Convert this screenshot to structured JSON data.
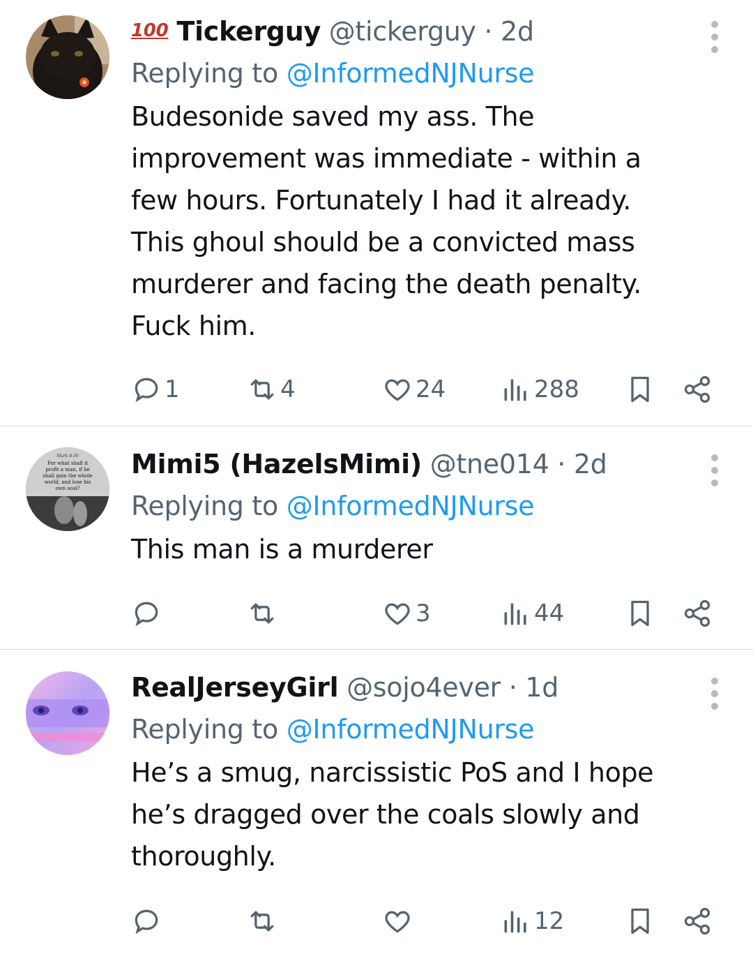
{
  "tweets": [
    {
      "badge": "100",
      "name": "Tickerguy",
      "handle": "@tickerguy",
      "separator": "·",
      "time": "2d",
      "replying_prefix": "Replying to",
      "replying_to": "@InformedNJNurse",
      "body_lines": [
        "Budesonide saved my ass. The",
        "improvement was immediate - within a",
        "few hours.  Fortunately I had it already.",
        "This ghoul should be a convicted mass",
        "murderer and facing the death penalty.",
        "Fuck him."
      ],
      "counts": {
        "replies": "1",
        "reposts": "4",
        "likes": "24",
        "views": "288"
      }
    },
    {
      "name": "Mimi5 (HazelsMimi)",
      "handle": "@tne014",
      "separator": "·",
      "time": "2d",
      "replying_prefix": "Replying to",
      "replying_to": "@InformedNJNurse",
      "body_lines": [
        "This man is a murderer"
      ],
      "avatar_text": [
        "Mark 8:36",
        "For what shall it",
        "profit a man, if he",
        "shall gain the whole",
        "world, and lose his",
        "own soul?"
      ],
      "counts": {
        "replies": "",
        "reposts": "",
        "likes": "3",
        "views": "44"
      }
    },
    {
      "name": "RealJerseyGirl",
      "handle": "@sojo4ever",
      "separator": "·",
      "time": "1d",
      "replying_prefix": "Replying to",
      "replying_to": "@InformedNJNurse",
      "body_lines": [
        "He’s a smug, narcissistic PoS and I hope",
        "he’s dragged over the coals slowly and",
        "thoroughly."
      ],
      "counts": {
        "replies": "",
        "reposts": "",
        "likes": "",
        "views": "12"
      }
    }
  ],
  "colors": {
    "link": "#1d9bf0",
    "secondary": "#536471",
    "text": "#0f1419",
    "divider": "#d9dde0"
  },
  "icons": [
    "reply-icon",
    "repost-icon",
    "like-icon",
    "views-icon",
    "bookmark-icon",
    "share-icon",
    "more-icon"
  ]
}
